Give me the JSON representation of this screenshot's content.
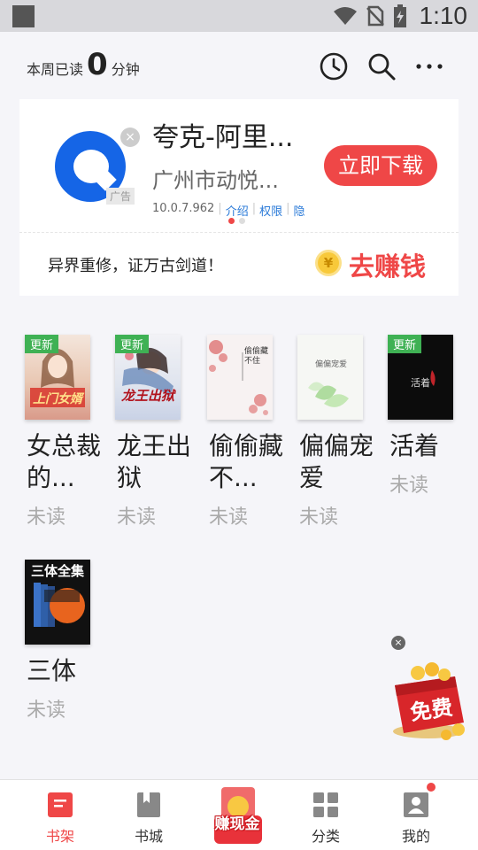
{
  "status_bar": {
    "time": "1:10"
  },
  "header": {
    "weekly_prefix": "本周已读",
    "weekly_minutes": "0",
    "weekly_suffix": "分钟"
  },
  "ad": {
    "title": "夸克-阿里...",
    "company": "广州市动悦...",
    "tag": "广告",
    "download_label": "立即下载",
    "version": "10.0.7.962",
    "links": [
      "介绍",
      "权限",
      "隐"
    ],
    "slogan": "异界重修，证万古剑道！",
    "earn_label": "去赚钱",
    "coin_symbol": "¥"
  },
  "books": [
    {
      "title": "女总裁的...",
      "status": "未读",
      "badge": "更新",
      "cover_text": "上门女婿"
    },
    {
      "title": "龙王出狱",
      "status": "未读",
      "badge": "更新",
      "cover_text": "龙王出狱"
    },
    {
      "title": "偷偷藏不...",
      "status": "未读",
      "badge": "",
      "cover_text": "偷偷藏不住"
    },
    {
      "title": "偏偏宠爱",
      "status": "未读",
      "badge": "",
      "cover_text": "偏偏宠爱"
    },
    {
      "title": "活着",
      "status": "未读",
      "badge": "更新",
      "cover_text": "活着"
    },
    {
      "title": "三体",
      "status": "未读",
      "badge": "",
      "cover_text": "三体全集"
    }
  ],
  "promo": {
    "label": "免费"
  },
  "bottom_nav": {
    "items": [
      {
        "label": "书架",
        "active": true
      },
      {
        "label": "书城",
        "active": false
      },
      {
        "label": "赚现金",
        "active": false
      },
      {
        "label": "分类",
        "active": false
      },
      {
        "label": "我的",
        "active": false
      }
    ]
  },
  "colors": {
    "accent": "#ef4747",
    "badge_green": "#3fb154",
    "link_blue": "#2a7ad8"
  }
}
